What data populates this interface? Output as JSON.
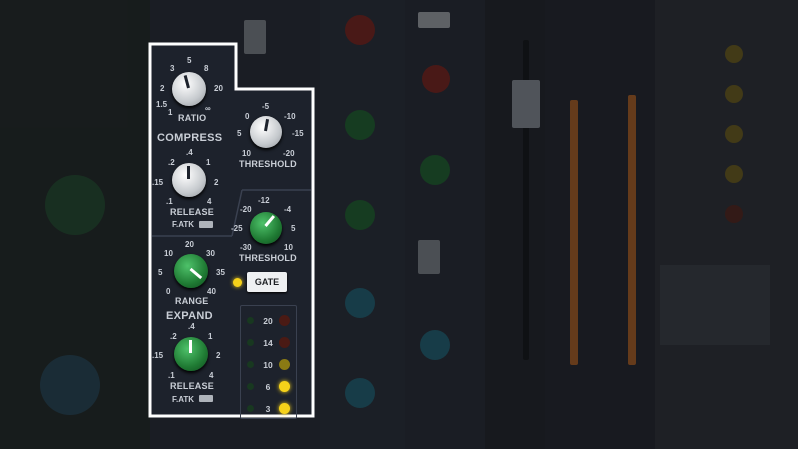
{
  "colors": {
    "panel_bg": "#1d222c",
    "highlight_border": "#ffffff",
    "knob_white": "#e8eaec",
    "knob_green": "#1f7a33",
    "led_yellow": "#f6d21a",
    "led_red_dim": "#4a1a14",
    "meter_orange": "#c8691e"
  },
  "compress": {
    "title": "COMPRESS",
    "ratio": {
      "label": "RATIO",
      "scale": [
        "5",
        "3",
        "8",
        "2",
        "20",
        "1.5",
        "1",
        "∞"
      ]
    },
    "threshold": {
      "label": "THRESHOLD",
      "scale": [
        "-5",
        "0",
        "-10",
        "5",
        "-15",
        "10",
        "-20"
      ]
    },
    "release": {
      "label": "RELEASE",
      "scale": [
        ".4",
        ".2",
        "1",
        ".15",
        "2",
        ".1",
        "4"
      ]
    },
    "fatk_label": "F.ATK"
  },
  "expand": {
    "title": "EXPAND",
    "threshold": {
      "label": "THRESHOLD",
      "scale": [
        "-12",
        "-20",
        "-4",
        "-25",
        "5",
        "-30",
        "10"
      ]
    },
    "range": {
      "label": "RANGE",
      "scale": [
        "20",
        "10",
        "30",
        "5",
        "35",
        "0",
        "40"
      ]
    },
    "release": {
      "label": "RELEASE",
      "scale": [
        ".4",
        ".2",
        "1",
        ".15",
        "2",
        ".1",
        "4"
      ]
    },
    "fatk_label": "F.ATK",
    "gate_button": "GATE"
  },
  "gain_reduction_meter": {
    "rows": [
      {
        "value": "20",
        "lit": false
      },
      {
        "value": "14",
        "lit": false
      },
      {
        "value": "10",
        "lit": "dim"
      },
      {
        "value": "6",
        "lit": true
      },
      {
        "value": "3",
        "lit": true
      }
    ]
  }
}
